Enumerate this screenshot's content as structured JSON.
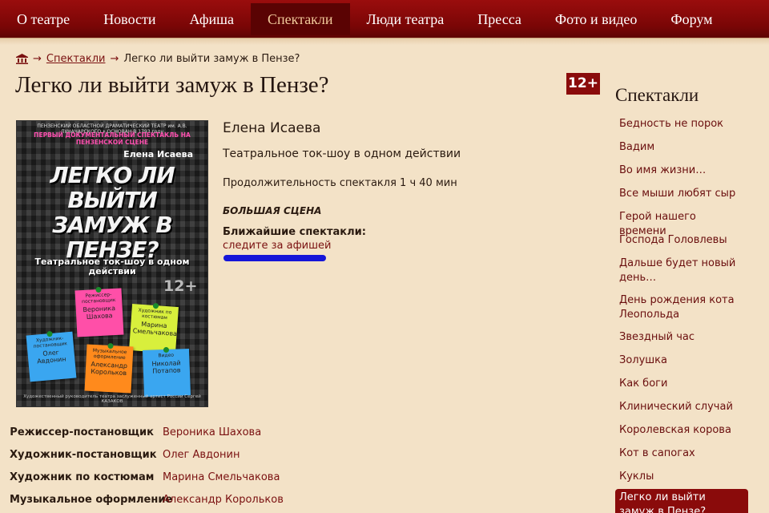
{
  "nav": {
    "items": [
      {
        "label": "О театре"
      },
      {
        "label": "Новости"
      },
      {
        "label": "Афиша"
      },
      {
        "label": "Спектакли",
        "active": true
      },
      {
        "label": "Люди театра"
      },
      {
        "label": "Пресса"
      },
      {
        "label": "Фото и видео"
      },
      {
        "label": "Форум"
      }
    ]
  },
  "breadcrumb": {
    "icon": "home-icon",
    "section": "Спектакли",
    "current": "Легко ли выйти замуж в Пензе?"
  },
  "page": {
    "title": "Легко ли выйти замуж в Пензе?",
    "age_badge": "12+"
  },
  "poster": {
    "org": "ПЕНЗЕНСКИЙ ОБЛАСТНОЙ ДРАМАТИЧЕСКИЙ ТЕАТР им. А.В. ЛУНАЧАРСКОГО • ОСНОВАН В 1793 году",
    "first": "ПЕРВЫЙ ДОКУМЕНТАЛЬНЫЙ СПЕКТАКЛЬ НА ПЕНЗЕНСКОЙ СЦЕНЕ",
    "author": "Елена Исаева",
    "big_title": "ЛЕГКО ЛИ ВЫЙТИ ЗАМУЖ В ПЕНЗЕ?",
    "subtitle": "Театральное ток-шоу в одном действии",
    "age": "12+",
    "notes": [
      {
        "role": "Режиссер-постановщик",
        "name": "Вероника Шахова",
        "color": "#ff4fa8"
      },
      {
        "role": "Художник по костюмам",
        "name": "Марина Смельчакова",
        "color": "#d8ef3c"
      },
      {
        "role": "Художник-постановщик",
        "name": "Олег Авдонин",
        "color": "#3aa6f0"
      },
      {
        "role": "Музыкальное оформление",
        "name": "Александр Корольков",
        "color": "#ff8a1c"
      },
      {
        "role": "Видео",
        "name": "Николай Потапов",
        "color": "#3aa6f0"
      }
    ],
    "footer": "Художественный руководитель театра заслуженный артист России Сергей КАЗАКОВ"
  },
  "info": {
    "author": "Елена Исаева",
    "genre": "Театральное ток-шоу в одном действии",
    "duration": "Продолжительность спектакля 1 ч 40 мин",
    "stage": "БОЛЬШАЯ СЦЕНА",
    "upcoming_label": "Ближайшие спектакли:",
    "upcoming_link": "следите за афишей"
  },
  "credits": [
    {
      "role": "Режиссер-постановщик",
      "name": "Вероника Шахова"
    },
    {
      "role": "Художник-постановщик",
      "name": "Олег Авдонин"
    },
    {
      "role": "Художник по костюмам",
      "name": "Марина Смельчакова"
    },
    {
      "role": "Музыкальное оформление",
      "name": "Александр Корольков"
    }
  ],
  "sidebar": {
    "title": "Спектакли",
    "items": [
      {
        "label": "Бедность не порок"
      },
      {
        "label": "Вадим"
      },
      {
        "label": "Во имя жизни…"
      },
      {
        "label": "Все мыши любят сыр"
      },
      {
        "label": "Герой нашего времени"
      },
      {
        "label": "Господа Головлевы"
      },
      {
        "label": "Дальше будет новый день…"
      },
      {
        "label": "День рождения кота Леопольда"
      },
      {
        "label": "Звездный час"
      },
      {
        "label": "Золушка"
      },
      {
        "label": "Как боги"
      },
      {
        "label": "Клинический случай"
      },
      {
        "label": "Королевская корова"
      },
      {
        "label": "Кот в сапогах"
      },
      {
        "label": "Куклы"
      },
      {
        "label": "Легко ли выйти замуж в Пензе?",
        "active": true
      }
    ]
  },
  "colors": {
    "nav_bg": "#8a0b0b",
    "page_bg": "#f3e2c7",
    "link": "#7a1010",
    "highlight_underline": "#1515d8"
  }
}
